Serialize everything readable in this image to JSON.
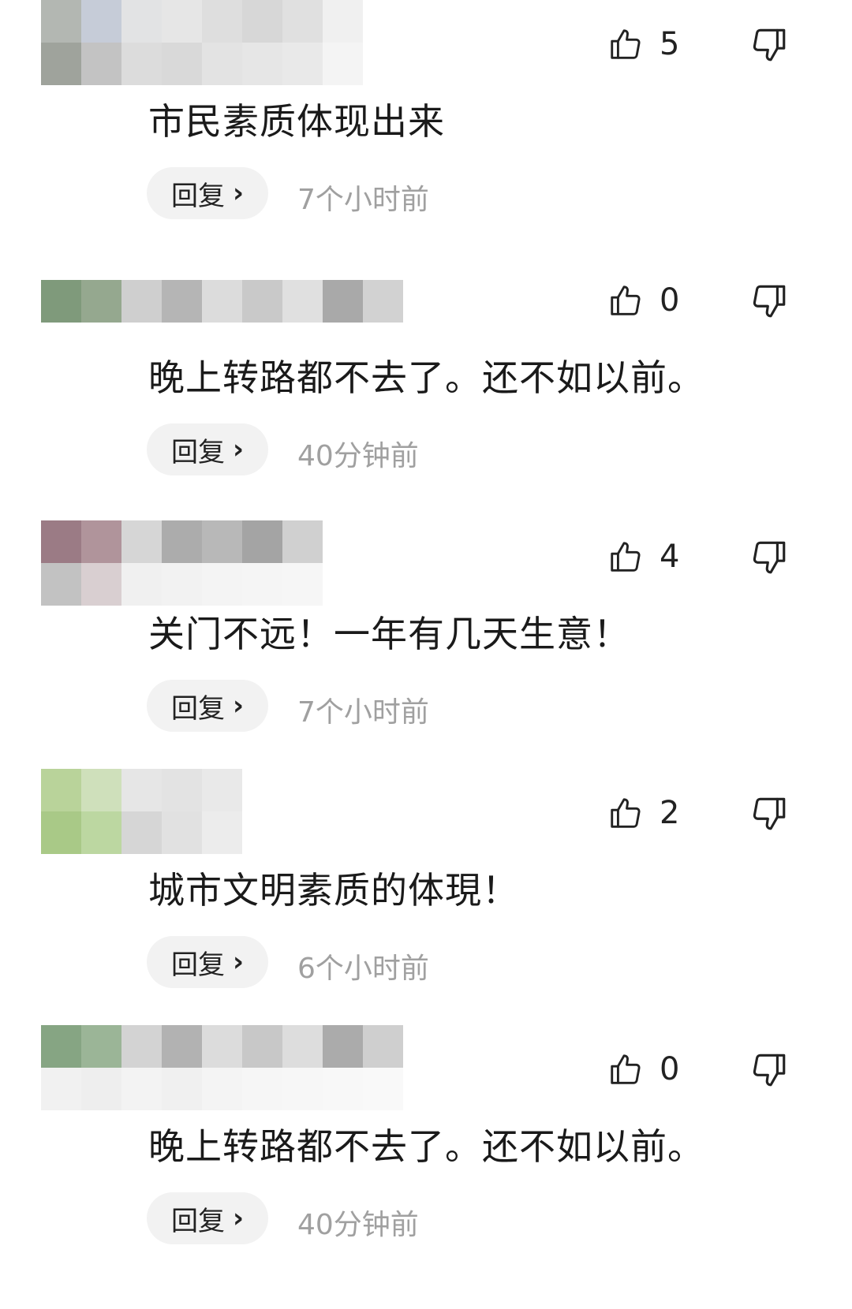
{
  "comments": [
    {
      "text": "市民素质体现出来",
      "likes": "5",
      "reply_label": "回复",
      "time": "7个小时前",
      "mosaic": [
        "#b3b7b2",
        "#c6ccd8",
        "#e2e3e4",
        "#e6e6e6",
        "#dedede",
        "#d7d7d7",
        "#e0e0e0",
        "#f0f0f0",
        "#9fa39c",
        "#c3c3c3",
        "#dcdcdc",
        "#d9d9d9",
        "#e3e3e3",
        "#e6e6e6",
        "#e9e9e9",
        "#f4f4f4"
      ]
    },
    {
      "text": "晚上转路都不去了。还不如以前。",
      "likes": "0",
      "reply_label": "回复",
      "time": "40分钟前",
      "mosaic": [
        "#7f9a7b",
        "#95a88f",
        "#cfcfcf",
        "#b5b5b5",
        "#dcdcdc",
        "#c9c9c9",
        "#e0e0e0",
        "#a9a9a9",
        "#d2d2d2"
      ]
    },
    {
      "text": "关门不远！一年有几天生意！",
      "likes": "4",
      "reply_label": "回复",
      "time": "7个小时前",
      "mosaic": [
        "#9b7b85",
        "#b0949b",
        "#d6d6d6",
        "#acacac",
        "#b8b8b8",
        "#a4a4a4",
        "#d0d0d0",
        "#c2c2c2",
        "#d9cfd1",
        "#f0f0f0",
        "#f2f2f2",
        "#f4f4f4",
        "#f5f5f5",
        "#f6f6f6"
      ]
    },
    {
      "text": "城市文明素质的体現！",
      "likes": "2",
      "reply_label": "回复",
      "time": "6个小时前",
      "mosaic": [
        "#b9d39a",
        "#cfe0bb",
        "#e6e6e6",
        "#e3e3e3",
        "#e9e9e9",
        "#a9c987",
        "#bcd7a1",
        "#d6d6d6",
        "#e1e1e1",
        "#ececec"
      ]
    },
    {
      "text": "晚上转路都不去了。还不如以前。",
      "likes": "0",
      "reply_label": "回复",
      "time": "40分钟前",
      "mosaic": [
        "#86a583",
        "#9bb597",
        "#d3d3d3",
        "#b2b2b2",
        "#dcdcdc",
        "#c8c8c8",
        "#dddddd",
        "#ababab",
        "#cfcfcf",
        "#f1f1f1",
        "#eeeeee",
        "#f3f3f3",
        "#f0f0f0",
        "#f4f4f4",
        "#f6f6f6",
        "#f7f7f7",
        "#f8f8f8",
        "#f9f9f9"
      ]
    }
  ],
  "colors": {
    "text": "#1a1a1a",
    "timestamp": "#a0a0a0",
    "reply_bg": "#f2f2f2"
  },
  "icons": {
    "like": "thumbs-up-outline",
    "dislike": "thumbs-down-outline"
  }
}
